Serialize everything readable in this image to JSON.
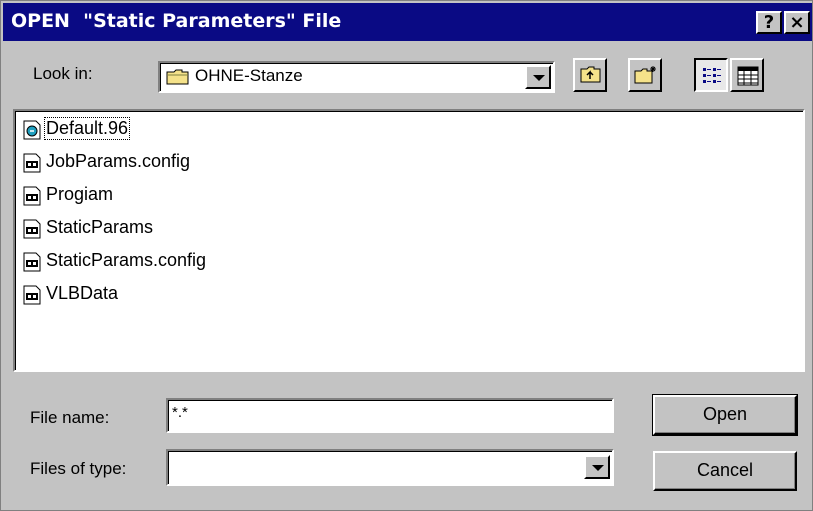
{
  "window": {
    "title": "OPEN  \"Static Parameters\" File",
    "help_label": "?",
    "close_label": "×"
  },
  "look_in": {
    "label": "Look in:",
    "value": "OHNE-Stanze"
  },
  "toolbar": {
    "up_icon": "up-folder-icon",
    "new_folder_icon": "new-folder-icon",
    "list_view_icon": "list-view-icon",
    "details_view_icon": "details-view-icon"
  },
  "files": [
    {
      "name": "Default.96",
      "icon": "special-file-icon"
    },
    {
      "name": "JobParams.config",
      "icon": "file-icon"
    },
    {
      "name": "Progiam",
      "icon": "file-icon"
    },
    {
      "name": "StaticParams",
      "icon": "file-icon"
    },
    {
      "name": "StaticParams.config",
      "icon": "file-icon"
    },
    {
      "name": "VLBData",
      "icon": "file-icon"
    }
  ],
  "file_name": {
    "label": "File name:",
    "value": "*.*"
  },
  "file_type": {
    "label": "Files of type:",
    "value": ""
  },
  "buttons": {
    "open": "Open",
    "cancel": "Cancel"
  }
}
